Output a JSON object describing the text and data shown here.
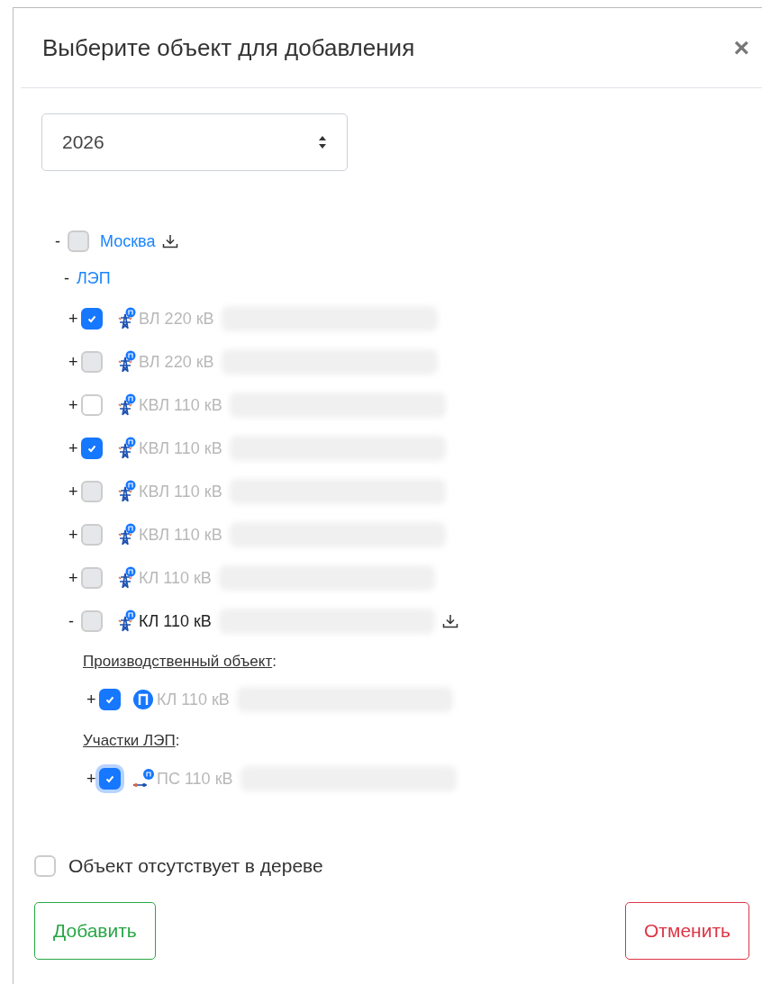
{
  "dialog": {
    "title": "Выберите объект для добавления",
    "close": "×"
  },
  "year_select": {
    "value": "2026"
  },
  "tree": {
    "toggle": "-",
    "label": "Москва",
    "checked": false,
    "disabled": true,
    "download": true,
    "children": [
      {
        "toggle": "-",
        "label": "ЛЭП",
        "items": [
          {
            "kind": "tower",
            "toggle": "+",
            "label": "ВЛ 220 кВ",
            "checked": true,
            "dimmed": true,
            "redacted": true
          },
          {
            "kind": "tower",
            "toggle": "+",
            "label": "ВЛ 220 кВ",
            "checked": false,
            "disabled": true,
            "dimmed": true,
            "redacted": true
          },
          {
            "kind": "tower",
            "toggle": "+",
            "label": "КВЛ 110 кВ",
            "checked": false,
            "disabled": false,
            "dimmed": true,
            "redacted": true
          },
          {
            "kind": "tower",
            "toggle": "+",
            "label": "КВЛ 110 кВ",
            "checked": true,
            "dimmed": true,
            "redacted": true
          },
          {
            "kind": "tower",
            "toggle": "+",
            "label": "КВЛ 110 кВ",
            "checked": false,
            "disabled": true,
            "dimmed": true,
            "redacted": true
          },
          {
            "kind": "tower",
            "toggle": "+",
            "label": "КВЛ 110 кВ",
            "checked": false,
            "disabled": true,
            "dimmed": true,
            "redacted": true
          },
          {
            "kind": "tower",
            "toggle": "+",
            "label": "КЛ 110 кВ",
            "checked": false,
            "disabled": true,
            "dimmed": true,
            "redacted": true
          },
          {
            "kind": "tower",
            "toggle": "-",
            "label": "КЛ 110 кВ",
            "checked": false,
            "disabled": true,
            "dimmed": false,
            "redacted": true,
            "download": true,
            "sections": [
              {
                "title": "Производственный объект",
                "suffix": ":",
                "items": [
                  {
                    "kind": "object",
                    "toggle": "+",
                    "label": "КЛ 110 кВ",
                    "checked": true,
                    "dimmed": true,
                    "redacted": true
                  }
                ]
              },
              {
                "title": "Участки ЛЭП",
                "suffix": ":",
                "items": [
                  {
                    "kind": "section",
                    "toggle": "+",
                    "label": "ПС 110 кВ",
                    "checked": true,
                    "focused": true,
                    "dimmed": true,
                    "redacted": true
                  }
                ]
              }
            ]
          }
        ]
      }
    ]
  },
  "missing_checkbox": {
    "label": "Объект отсутствует в дереве",
    "checked": false
  },
  "buttons": [
    {
      "kind": "add",
      "label": "Добавить"
    },
    {
      "kind": "cancel",
      "label": "Отменить"
    }
  ]
}
